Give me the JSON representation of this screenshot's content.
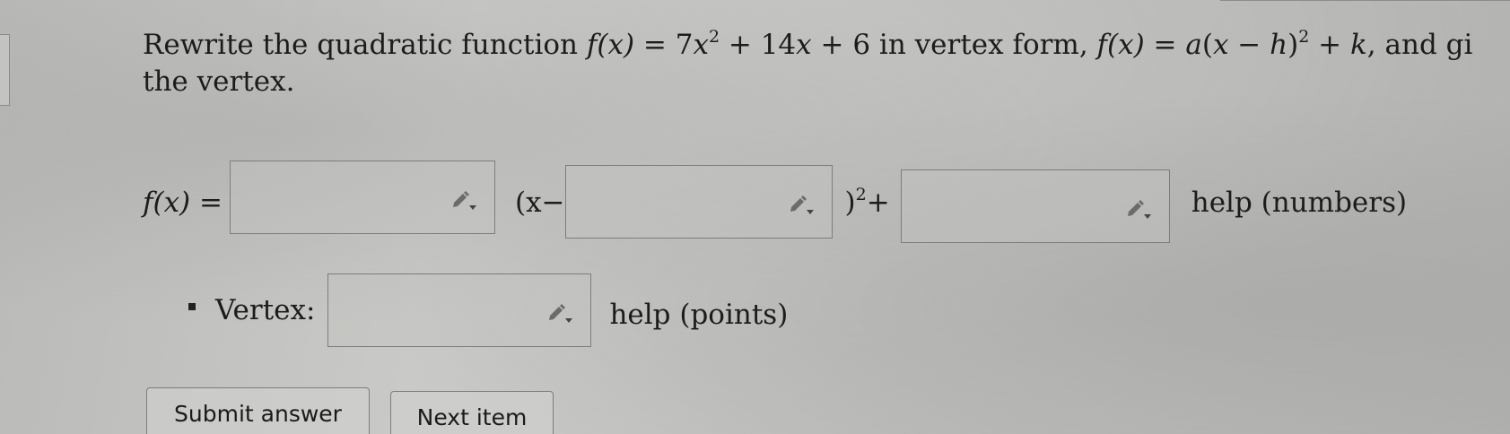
{
  "question": {
    "prefix": "Rewrite the quadratic function ",
    "fx": "f(x)",
    "eq1": " = 7",
    "x1": "x",
    "exp1": "2",
    "mid1": " + 14",
    "x2": "x",
    "mid2": " + 6 in vertex form, ",
    "fx2": "f(x)",
    "eq2": " = ",
    "a": "a",
    "paren1": "(",
    "x3": "x",
    "minus": " − ",
    "h": "h",
    "paren2": ")",
    "exp2": "2",
    "plus": " + ",
    "k": "k",
    "tail": ", and gi",
    "line2": "the vertex."
  },
  "answer_row": {
    "lhs": "f(x) =",
    "open": "(x−",
    "close": ")",
    "exp": "2",
    "plus": "+",
    "a_value": "",
    "h_value": "",
    "k_value": "",
    "help": "help (numbers)"
  },
  "vertex_row": {
    "label": "Vertex:",
    "value": "",
    "help": "help (points)"
  },
  "buttons": {
    "submit": "Submit answer",
    "next": "Next item"
  },
  "icons": {
    "input_icon": "pencil-dropdown-icon"
  }
}
